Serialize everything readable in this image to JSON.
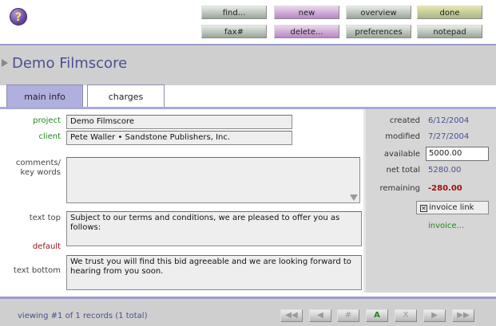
{
  "toolbar": {
    "help_glyph": "?",
    "buttons": [
      {
        "label": "find...",
        "color": "gray"
      },
      {
        "label": "new",
        "color": "pink"
      },
      {
        "label": "overview",
        "color": "gray"
      },
      {
        "label": "done",
        "color": "yellow"
      },
      {
        "label": "fax#",
        "color": "gray"
      },
      {
        "label": "delete...",
        "color": "pink"
      },
      {
        "label": "preferences",
        "color": "gray"
      },
      {
        "label": "notepad",
        "color": "gray"
      }
    ]
  },
  "header": {
    "title": "Demo Filmscore"
  },
  "tabs": [
    {
      "label": "main info"
    },
    {
      "label": "charges"
    }
  ],
  "form": {
    "project_label": "project",
    "project_value": "Demo Filmscore",
    "client_label": "client",
    "client_value": "Pete Waller • Sandstone Publishers, Inc.",
    "comments_label": "comments/\nkey words",
    "comments_value": "",
    "text_top_label": "text top",
    "text_top_value": "Subject to our terms and conditions, we are pleased to offer you as follows:",
    "default_label": "default",
    "text_bottom_label": "text bottom",
    "text_bottom_value": "We trust you will find this bid agreeable and we are looking forward to hearing from you soon."
  },
  "summary": {
    "created_label": "created",
    "created_value": "6/12/2004",
    "modified_label": "modified",
    "modified_value": "7/27/2004",
    "available_label": "available",
    "available_value": "5000.00",
    "net_total_label": "net total",
    "net_total_value": "5280.00",
    "remaining_label": "remaining",
    "remaining_value": "-280.00",
    "invoice_link_label": "invoice link",
    "invoice_link_checked": "✕",
    "invoice_action": "invoice..."
  },
  "footer": {
    "status": "viewing #1 of 1 records (1 total)",
    "nav": {
      "first": "◀◀",
      "prev": "◀",
      "goto": "#",
      "all": "A",
      "omit": "X",
      "next": "▶",
      "last": "▶▶"
    }
  },
  "colors": {
    "accent": "#4a4f91",
    "green": "#1d8a1d",
    "red": "#a01010",
    "tab_active": "#b0b0de"
  }
}
